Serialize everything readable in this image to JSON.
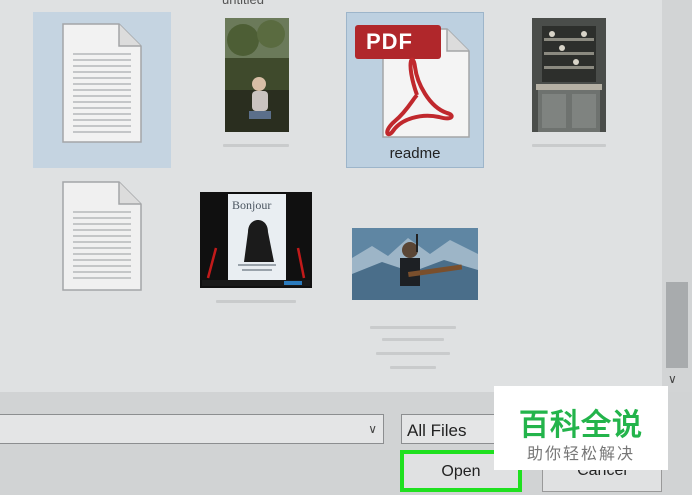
{
  "files": {
    "top_label": "untitled",
    "items": [
      {
        "name": "",
        "kind": "document"
      },
      {
        "name": "",
        "kind": "photo-child-outdoors"
      },
      {
        "name": "readme",
        "kind": "pdf"
      },
      {
        "name": "",
        "kind": "photo-kitchen-shelf"
      },
      {
        "name": "",
        "kind": "document"
      },
      {
        "name": "",
        "kind": "image-bonjour-poster"
      },
      {
        "name": "",
        "kind": "photo-guitarist-concert"
      }
    ],
    "pdf_badge": "PDF"
  },
  "bottom": {
    "filename_value": "",
    "filetype_value": "All Files",
    "open_label": "Open",
    "cancel_label": "Cancel"
  },
  "watermark": {
    "main": "百科全说",
    "sub": "助你轻松解决"
  },
  "poster_text": "Bonjour",
  "colors": {
    "selection": "#c5d4e1",
    "highlight": "#1fe01f",
    "watermark_green": "#23b44b"
  }
}
